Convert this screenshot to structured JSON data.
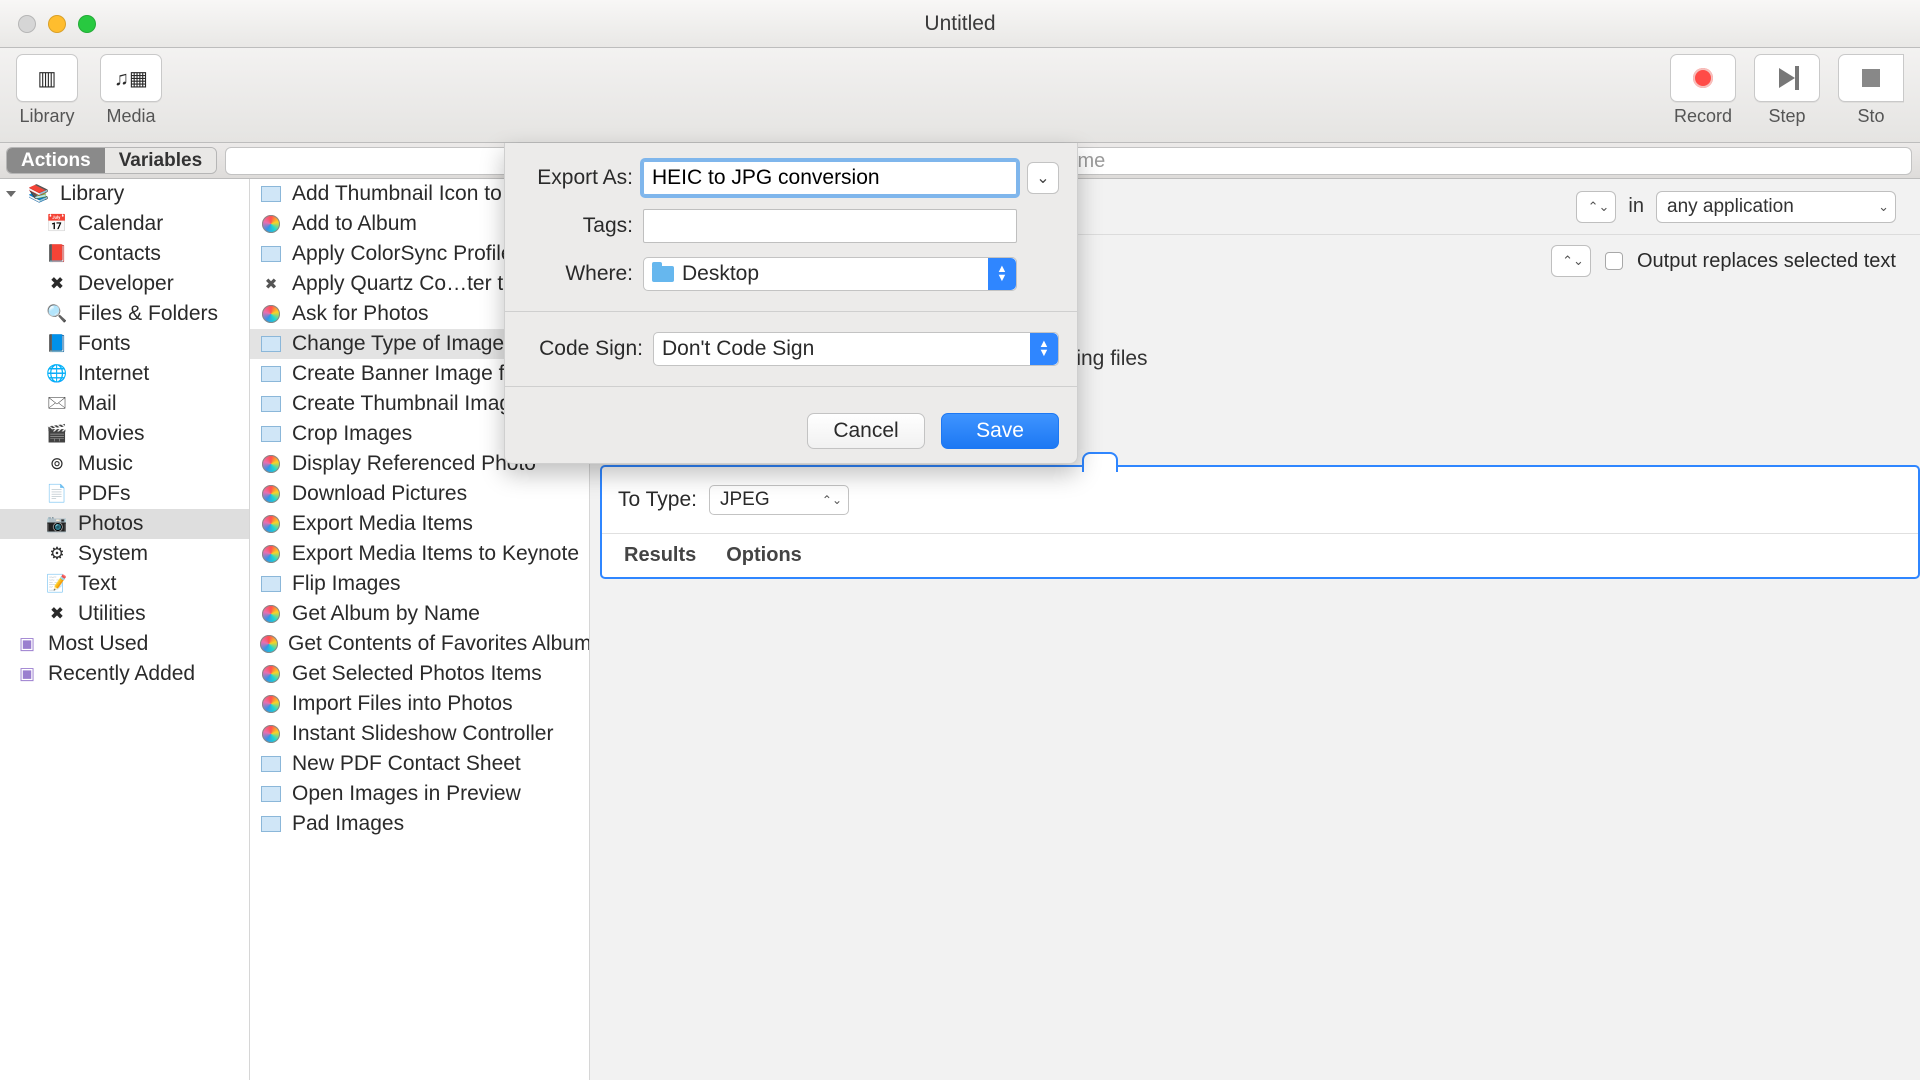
{
  "window": {
    "title": "Untitled"
  },
  "toolbar": {
    "library": "Library",
    "media": "Media",
    "record": "Record",
    "step": "Step",
    "stop": "Sto"
  },
  "segmented": {
    "actions": "Actions",
    "variables": "Variables"
  },
  "search": {
    "placeholder": "Name"
  },
  "sidebar": {
    "root": "Library",
    "items": [
      {
        "label": "Calendar",
        "icon": "📅"
      },
      {
        "label": "Contacts",
        "icon": "📕"
      },
      {
        "label": "Developer",
        "icon": "✖︎"
      },
      {
        "label": "Files & Folders",
        "icon": "🔍"
      },
      {
        "label": "Fonts",
        "icon": "📘"
      },
      {
        "label": "Internet",
        "icon": "🌐"
      },
      {
        "label": "Mail",
        "icon": "🖂"
      },
      {
        "label": "Movies",
        "icon": "🎬"
      },
      {
        "label": "Music",
        "icon": "⊚"
      },
      {
        "label": "PDFs",
        "icon": "📄"
      },
      {
        "label": "Photos",
        "icon": "📷",
        "selected": true
      },
      {
        "label": "System",
        "icon": "⚙︎"
      },
      {
        "label": "Text",
        "icon": "📝"
      },
      {
        "label": "Utilities",
        "icon": "✖︎"
      }
    ],
    "smart": [
      {
        "label": "Most Used",
        "icon": "📁"
      },
      {
        "label": "Recently Added",
        "icon": "📁"
      }
    ]
  },
  "actions": [
    {
      "label": "Add Thumbnail Icon to Im",
      "kind": "thumb"
    },
    {
      "label": "Add to Album",
      "kind": "gear"
    },
    {
      "label": "Apply ColorSync Profile t",
      "kind": "thumb"
    },
    {
      "label": "Apply Quartz Co…ter to I",
      "kind": "x"
    },
    {
      "label": "Ask for Photos",
      "kind": "gear"
    },
    {
      "label": "Change Type of Images",
      "kind": "thumb",
      "selected": true
    },
    {
      "label": "Create Banner Image from",
      "kind": "thumb"
    },
    {
      "label": "Create Thumbnail Images",
      "kind": "thumb"
    },
    {
      "label": "Crop Images",
      "kind": "thumb"
    },
    {
      "label": "Display Referenced Photo",
      "kind": "gear"
    },
    {
      "label": "Download Pictures",
      "kind": "gear"
    },
    {
      "label": "Export Media Items",
      "kind": "gear"
    },
    {
      "label": "Export Media Items to Keynote",
      "kind": "gear"
    },
    {
      "label": "Flip Images",
      "kind": "thumb"
    },
    {
      "label": "Get Album by Name",
      "kind": "gear"
    },
    {
      "label": "Get Contents of Favorites Album",
      "kind": "gear"
    },
    {
      "label": "Get Selected Photos Items",
      "kind": "gear"
    },
    {
      "label": "Import Files into Photos",
      "kind": "gear"
    },
    {
      "label": "Instant Slideshow Controller",
      "kind": "gear"
    },
    {
      "label": "New PDF Contact Sheet",
      "kind": "thumb"
    },
    {
      "label": "Open Images in Preview",
      "kind": "thumb"
    },
    {
      "label": "Pad Images",
      "kind": "thumb"
    }
  ],
  "workflow": {
    "receives_label_in": "in",
    "receives_app": "any application",
    "output_replaces": "Output replaces selected text",
    "existing_files": "sting files",
    "action": {
      "to_type_label": "To Type:",
      "to_type_value": "JPEG",
      "tabs": {
        "results": "Results",
        "options": "Options"
      }
    }
  },
  "sheet": {
    "export_as_label": "Export As:",
    "export_as_value": "HEIC to JPG conversion",
    "tags_label": "Tags:",
    "tags_value": "",
    "where_label": "Where:",
    "where_value": "Desktop",
    "codesign_label": "Code Sign:",
    "codesign_value": "Don't Code Sign",
    "cancel": "Cancel",
    "save": "Save"
  }
}
